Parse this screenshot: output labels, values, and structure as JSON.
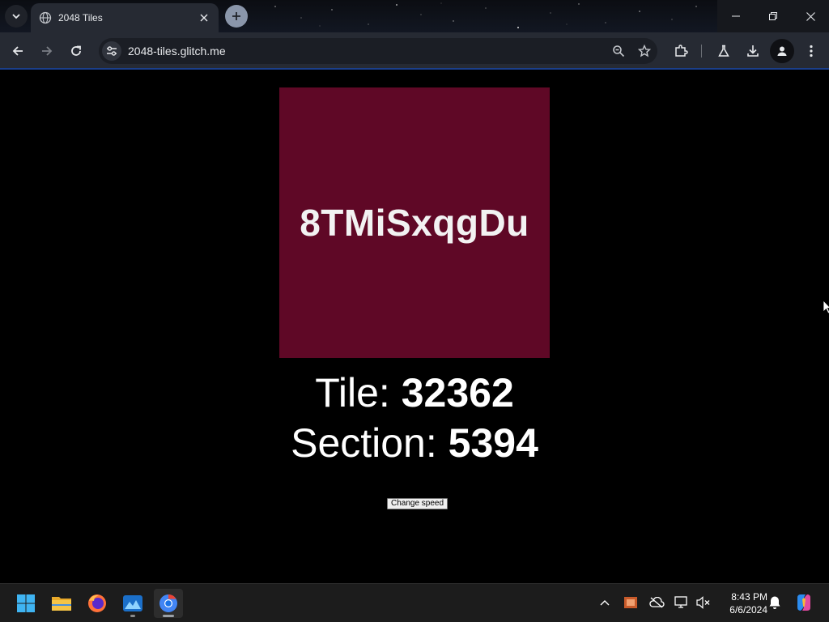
{
  "browser": {
    "tab_title": "2048 Tiles",
    "url": "2048-tiles.glitch.me"
  },
  "page": {
    "tile_text": "8TMiSxqgDu",
    "tile_color": "#5f0826",
    "tile_label": "Tile: ",
    "tile_number": "32362",
    "section_label": "Section: ",
    "section_number": "5394",
    "speed_button": "Change speed"
  },
  "taskbar": {
    "apps": [
      "start-icon",
      "file-explorer-icon",
      "firefox-icon",
      "photos-icon",
      "chrome-icon"
    ],
    "time": "8:43 PM",
    "date": "6/6/2024"
  },
  "colors": {
    "toolbar_bg": "#262a33",
    "page_bg": "#000000",
    "accent_blue": "#1b3f8a"
  }
}
